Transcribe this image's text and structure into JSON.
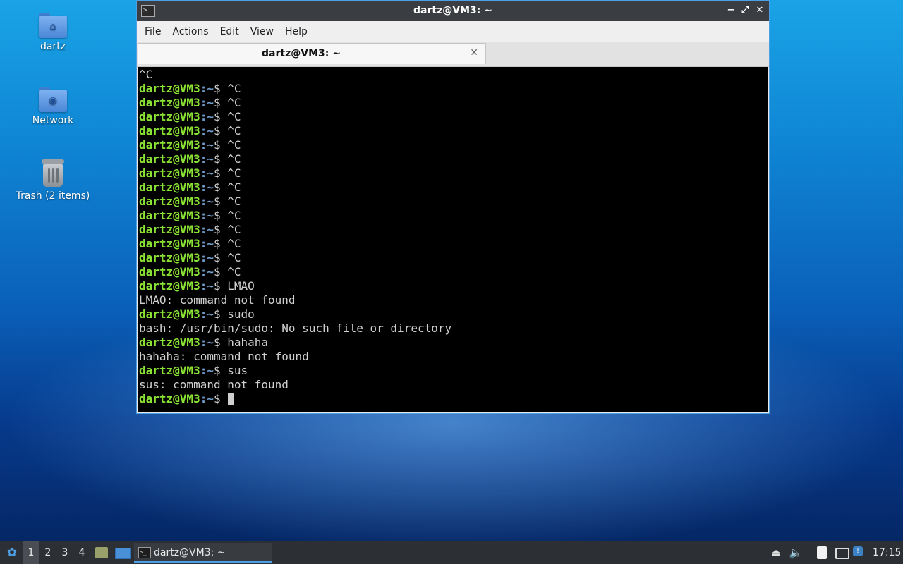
{
  "desktop": {
    "icons": [
      {
        "label": "dartz",
        "icon": "home-folder-icon"
      },
      {
        "label": "Network",
        "icon": "network-folder-icon"
      },
      {
        "label": "Trash (2 items)",
        "icon": "trash-icon"
      }
    ]
  },
  "window": {
    "title": "dartz@VM3: ~",
    "controls": {
      "minimize": "−",
      "maximize": "⤢",
      "close": "✕"
    },
    "menu": [
      "File",
      "Actions",
      "Edit",
      "View",
      "Help"
    ],
    "tab": {
      "label": "dartz@VM3: ~",
      "close": "✕"
    }
  },
  "terminal": {
    "prompt_user": "dartz@VM3",
    "prompt_path": ":~",
    "prompt_symbol": "$ ",
    "lines": [
      {
        "kind": "out",
        "text": "^C"
      },
      {
        "kind": "prompt",
        "text": "^C"
      },
      {
        "kind": "prompt",
        "text": "^C"
      },
      {
        "kind": "prompt",
        "text": "^C"
      },
      {
        "kind": "prompt",
        "text": "^C"
      },
      {
        "kind": "prompt",
        "text": "^C"
      },
      {
        "kind": "prompt",
        "text": "^C"
      },
      {
        "kind": "prompt",
        "text": "^C"
      },
      {
        "kind": "prompt",
        "text": "^C"
      },
      {
        "kind": "prompt",
        "text": "^C"
      },
      {
        "kind": "prompt",
        "text": "^C"
      },
      {
        "kind": "prompt",
        "text": "^C"
      },
      {
        "kind": "prompt",
        "text": "^C"
      },
      {
        "kind": "prompt",
        "text": "^C"
      },
      {
        "kind": "prompt",
        "text": "^C"
      },
      {
        "kind": "prompt",
        "text": "LMAO"
      },
      {
        "kind": "out",
        "text": "LMAO: command not found"
      },
      {
        "kind": "prompt",
        "text": "sudo"
      },
      {
        "kind": "out",
        "text": "bash: /usr/bin/sudo: No such file or directory"
      },
      {
        "kind": "prompt",
        "text": "hahaha"
      },
      {
        "kind": "out",
        "text": "hahaha: command not found"
      },
      {
        "kind": "prompt",
        "text": "sus"
      },
      {
        "kind": "out",
        "text": "sus: command not found"
      },
      {
        "kind": "prompt",
        "text": "",
        "cursor": true
      }
    ]
  },
  "taskbar": {
    "workspaces": [
      "1",
      "2",
      "3",
      "4"
    ],
    "active_workspace": "1",
    "window_button": "dartz@VM3: ~",
    "clock": "17:15"
  },
  "colors": {
    "prompt_user": "#8ae234",
    "prompt_path": "#729fcf",
    "accent": "#4ea0e6"
  }
}
